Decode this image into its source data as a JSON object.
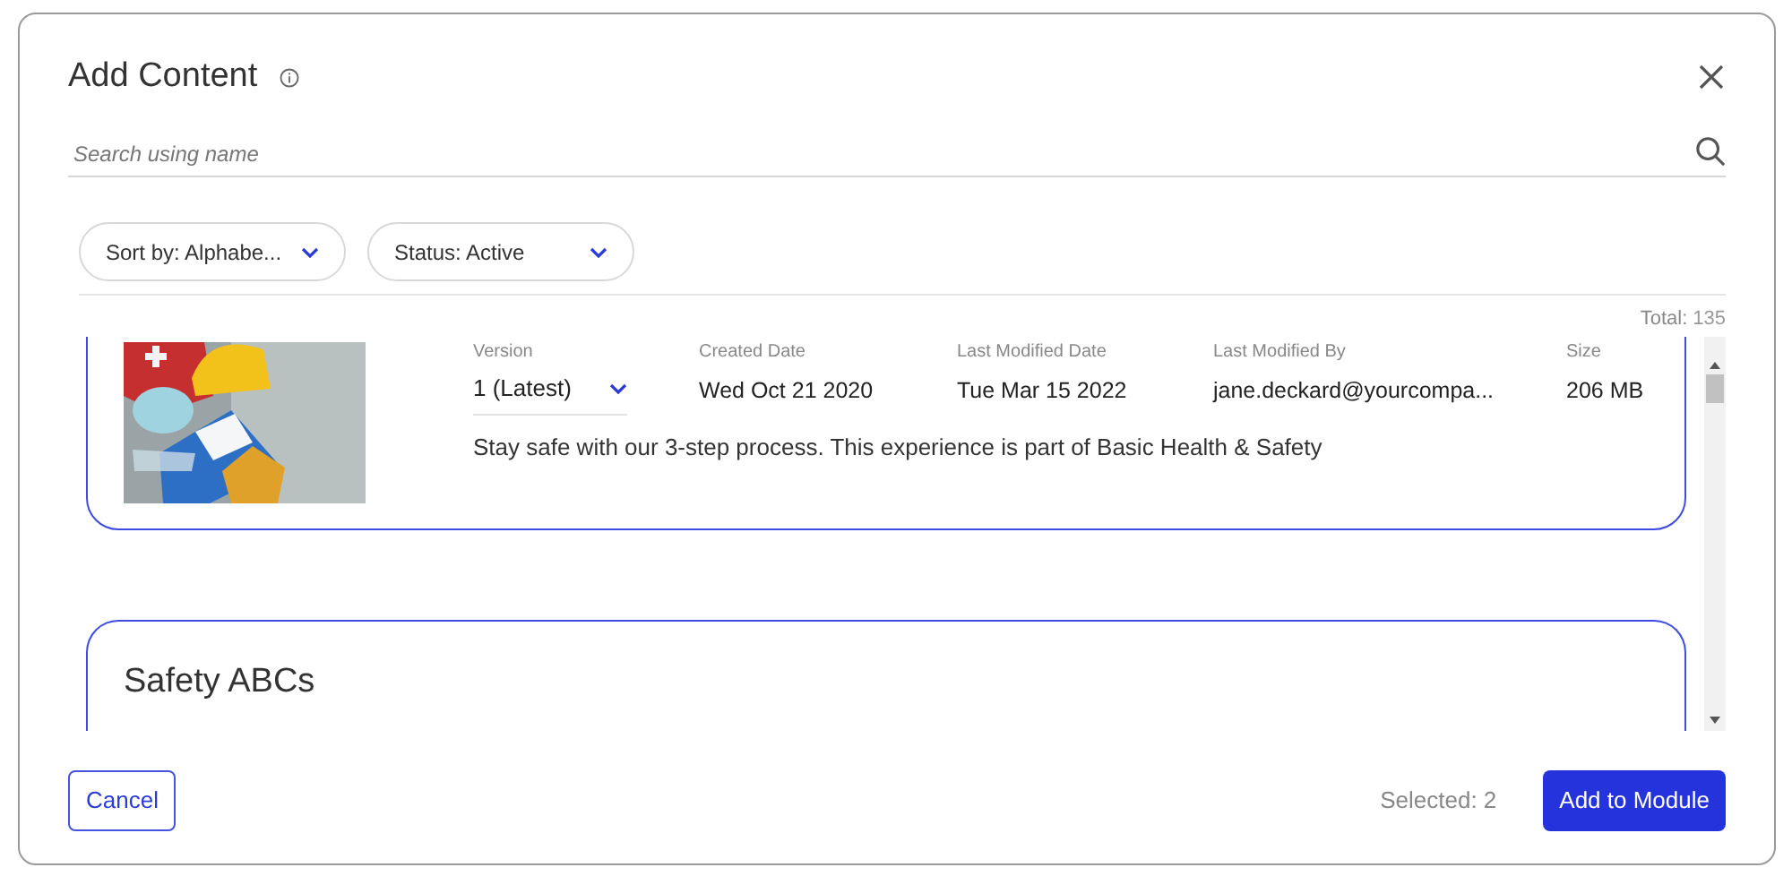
{
  "dialog": {
    "title": "Add Content"
  },
  "search": {
    "placeholder": "Search using name"
  },
  "filters": [
    {
      "label": "Sort by: Alphabe..."
    },
    {
      "label": "Status: Active"
    }
  ],
  "total": {
    "label": "Total:",
    "value": "135"
  },
  "items": [
    {
      "kind": "detailed",
      "columns": [
        {
          "header": "Version",
          "value": "1 (Latest)",
          "kind": "select"
        },
        {
          "header": "Created Date",
          "value": "Wed Oct 21 2020",
          "kind": "text"
        },
        {
          "header": "Last Modified Date",
          "value": "Tue Mar 15 2022",
          "kind": "text"
        },
        {
          "header": "Last Modified By",
          "value": "jane.deckard@yourcompa...",
          "kind": "text"
        },
        {
          "header": "Size",
          "value": "206 MB",
          "kind": "text"
        }
      ],
      "description": "Stay safe with our 3-step process. This experience is part of Basic Health & Safety"
    },
    {
      "kind": "titled",
      "title": "Safety ABCs"
    }
  ],
  "footer": {
    "cancel": "Cancel",
    "selected": "Selected: 2",
    "confirm": "Add to Module"
  }
}
